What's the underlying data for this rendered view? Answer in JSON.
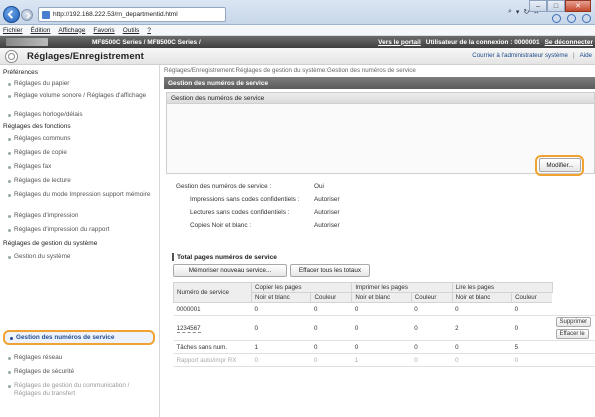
{
  "browser": {
    "url": "http://192.168.222.53/rn_departmentid.html",
    "menu": [
      "Fichier",
      "Édition",
      "Affichage",
      "Favoris",
      "Outils",
      "?"
    ]
  },
  "devbar": {
    "model": "MF8500C Series / MF8500C Series /",
    "portal_link": "Vers le portail",
    "user_label": "Utilisateur de la connexion : 0000001",
    "logout_link": "Se déconnecter"
  },
  "titlebar": {
    "title": "Réglages/Enregistrement",
    "mail_admin": "Courrier à l'administrateur système",
    "help": "Aide"
  },
  "sidebar": {
    "groups": [
      {
        "label": "Préférences",
        "items": [
          "Réglages du papier",
          "Réglage volume sonore / Réglages d'affichage",
          "Réglages horloge/délais"
        ]
      },
      {
        "label": "Réglages des fonctions",
        "items": [
          "Réglages communs",
          "Réglages de copie",
          "Réglages fax",
          "Réglages de lecture",
          "Réglages du mode Impression support mémoire",
          "Réglages d'impression",
          "Réglages d'impression du rapport"
        ]
      },
      {
        "label": "Réglages de gestion du système",
        "items": [
          "Gestion du système",
          "Gestion des numéros de service",
          "Réglages réseau",
          "Réglages de sécurité",
          "Réglages de gestion du communication / Réglages du transfert"
        ]
      }
    ]
  },
  "main": {
    "breadcrumb": "Réglages/Enregistrement:Réglages de gestion du système:Gestion des numéros de service",
    "section_title": "Gestion des numéros de service",
    "subpanel_title": "Gestion des numéros de service",
    "modify_button": "Modifier...",
    "info": [
      {
        "label": "Gestion des numéros de service :",
        "value": "Oui"
      },
      {
        "label": "Impressions sans codes confidentiels :",
        "value": "Autoriser"
      },
      {
        "label": "Lectures sans codes confidentiels :",
        "value": "Autoriser"
      },
      {
        "label": "Copies Noir et blanc :",
        "value": "Autoriser"
      }
    ],
    "total_title": "Total pages numéros de service",
    "save_button": "Mémoriser nouveau service...",
    "clear_button": "Effacer tous les totaux",
    "table": {
      "col_number": "Numéro de service",
      "groups": [
        "Copier les pages",
        "Imprimer les pages",
        "Lire les pages"
      ],
      "sub": [
        "Noir et blanc",
        "Couleur",
        "Noir et blanc",
        "Couleur",
        "Noir et blanc",
        "Couleur"
      ],
      "rows": [
        {
          "id": "0000001",
          "vals": [
            "0",
            "0",
            "0",
            "0",
            "0",
            "0"
          ]
        },
        {
          "id": "1234567",
          "vals": [
            "0",
            "0",
            "0",
            "0",
            "2",
            "0"
          ]
        },
        {
          "id": "Tâches sans num.",
          "vals": [
            "1",
            "0",
            "0",
            "0",
            "0",
            "5"
          ]
        },
        {
          "id": "Rapport auto/impr RX",
          "vals": [
            "0",
            "0",
            "1",
            "0",
            "0",
            "0"
          ]
        }
      ],
      "delete_button": "Supprimer",
      "clear_button": "Effacer le"
    }
  },
  "colors": {
    "highlight": "#f0a232",
    "link": "#1f4d90"
  }
}
